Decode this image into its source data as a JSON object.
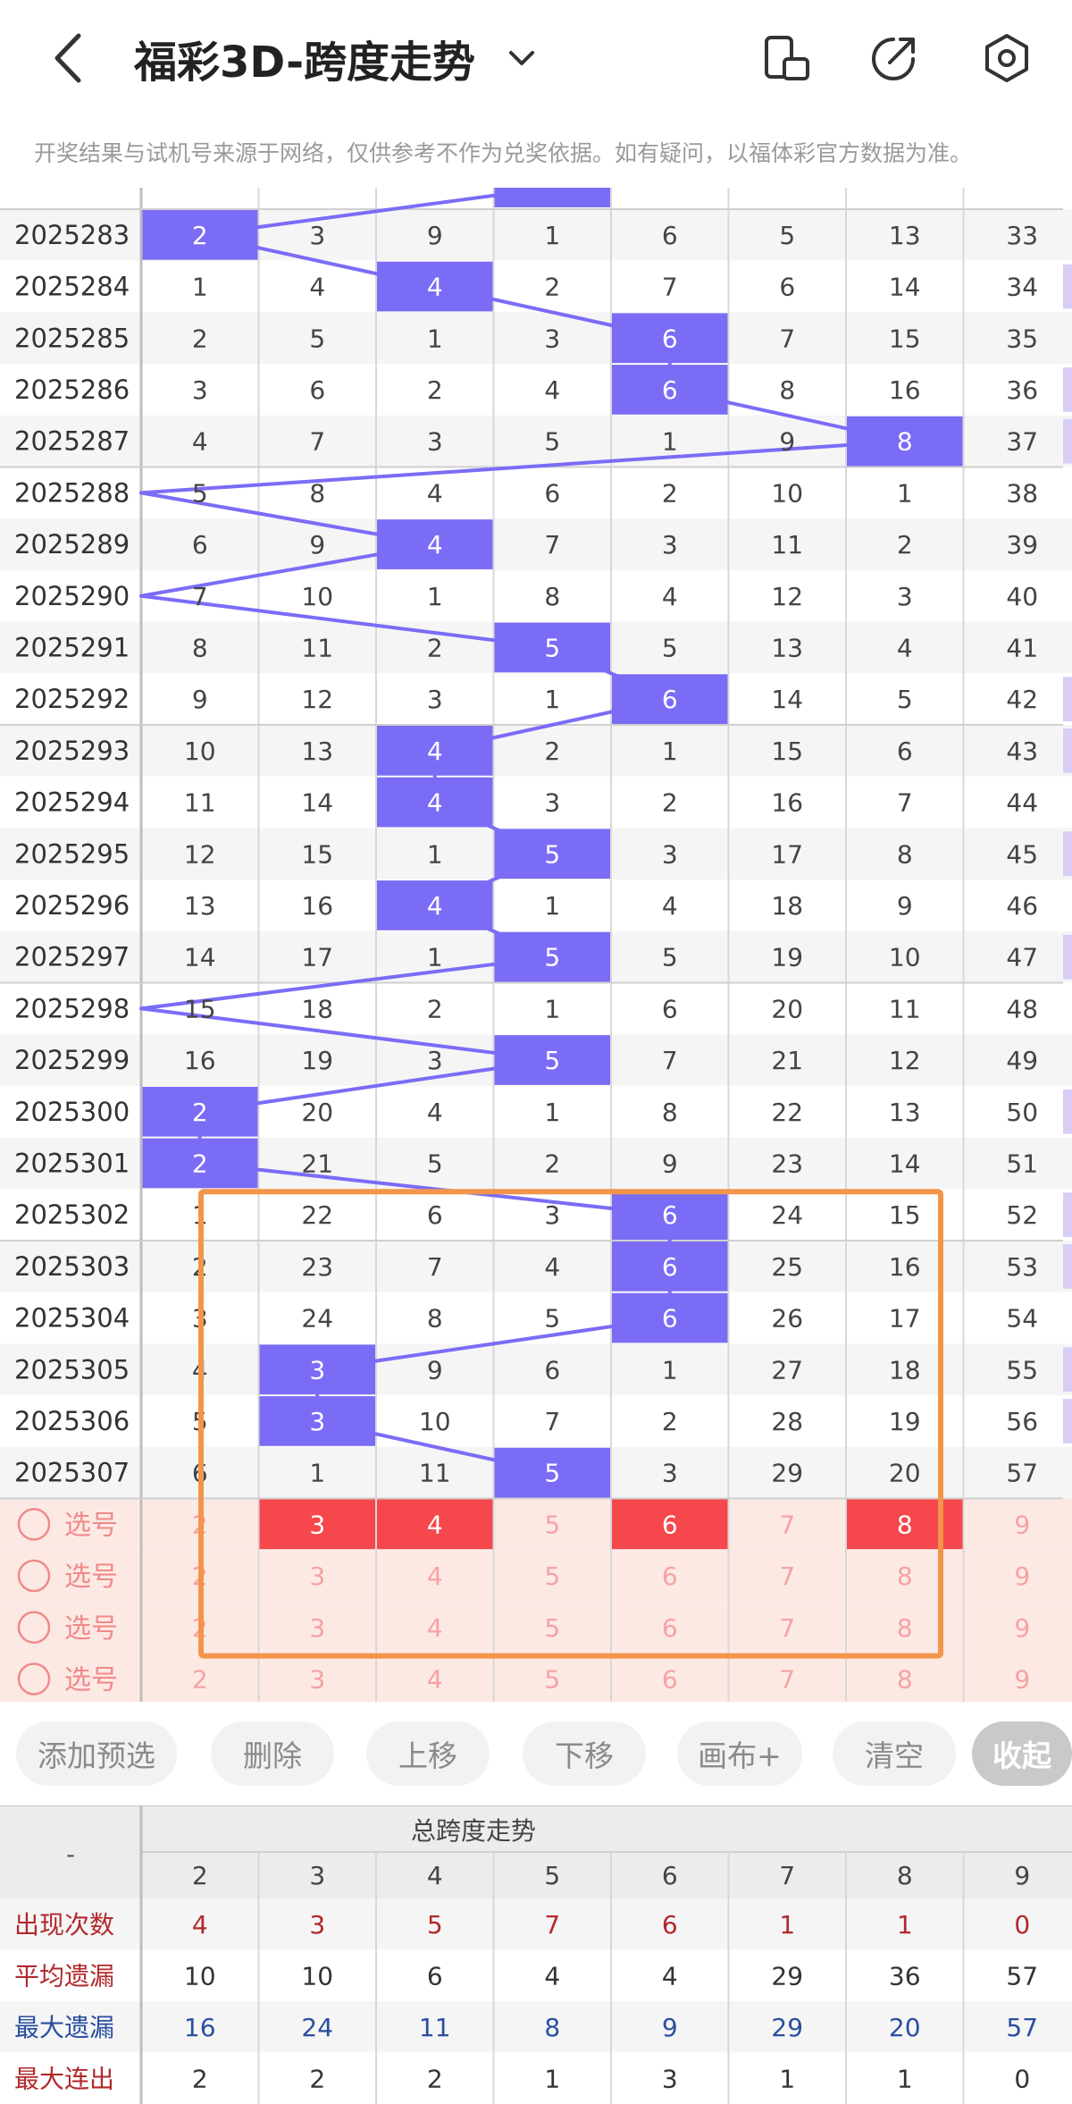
{
  "header": {
    "title": "福彩3D-跨度走势",
    "notice": "开奖结果与试机号来源于网络，仅供参考不作为兑奖依据。如有疑问，以福体彩官方数据为准。"
  },
  "icons": {
    "back": "back-arrow-icon",
    "dropdown": "chevron-down-icon",
    "phone": "phone-rotate-icon",
    "share": "share-icon",
    "settings": "settings-gear-icon"
  },
  "colors": {
    "highlight": "#7B6CF6",
    "pick": "#F5474C",
    "pick_bg": "#FDE9E4",
    "stat_red": "#B2292C",
    "stat_blue": "#2A4FA0",
    "box": "#F2954B"
  },
  "columns": [
    "2",
    "3",
    "4",
    "5",
    "6",
    "7",
    "8",
    "9"
  ],
  "rows": [
    {
      "issue": "2025283",
      "vals": [
        "2",
        "3",
        "9",
        "1",
        "6",
        "5",
        "13",
        "33"
      ],
      "hit": 0
    },
    {
      "issue": "2025284",
      "vals": [
        "1",
        "4",
        "4",
        "2",
        "7",
        "6",
        "14",
        "34"
      ],
      "hit": 2
    },
    {
      "issue": "2025285",
      "vals": [
        "2",
        "5",
        "1",
        "3",
        "6",
        "7",
        "15",
        "35"
      ],
      "hit": 4
    },
    {
      "issue": "2025286",
      "vals": [
        "3",
        "6",
        "2",
        "4",
        "6",
        "8",
        "16",
        "36"
      ],
      "hit": 4
    },
    {
      "issue": "2025287",
      "vals": [
        "4",
        "7",
        "3",
        "5",
        "1",
        "9",
        "8",
        "37"
      ],
      "hit": 6
    },
    {
      "issue": "2025288",
      "vals": [
        "5",
        "8",
        "4",
        "6",
        "2",
        "10",
        "1",
        "38"
      ],
      "hit": -1
    },
    {
      "issue": "2025289",
      "vals": [
        "6",
        "9",
        "4",
        "7",
        "3",
        "11",
        "2",
        "39"
      ],
      "hit": 2
    },
    {
      "issue": "2025290",
      "vals": [
        "7",
        "10",
        "1",
        "8",
        "4",
        "12",
        "3",
        "40"
      ],
      "hit": -1
    },
    {
      "issue": "2025291",
      "vals": [
        "8",
        "11",
        "2",
        "5",
        "5",
        "13",
        "4",
        "41"
      ],
      "hit": 3
    },
    {
      "issue": "2025292",
      "vals": [
        "9",
        "12",
        "3",
        "1",
        "6",
        "14",
        "5",
        "42"
      ],
      "hit": 4
    },
    {
      "issue": "2025293",
      "vals": [
        "10",
        "13",
        "4",
        "2",
        "1",
        "15",
        "6",
        "43"
      ],
      "hit": 2
    },
    {
      "issue": "2025294",
      "vals": [
        "11",
        "14",
        "4",
        "3",
        "2",
        "16",
        "7",
        "44"
      ],
      "hit": 2
    },
    {
      "issue": "2025295",
      "vals": [
        "12",
        "15",
        "1",
        "5",
        "3",
        "17",
        "8",
        "45"
      ],
      "hit": 3
    },
    {
      "issue": "2025296",
      "vals": [
        "13",
        "16",
        "4",
        "1",
        "4",
        "18",
        "9",
        "46"
      ],
      "hit": 2
    },
    {
      "issue": "2025297",
      "vals": [
        "14",
        "17",
        "1",
        "5",
        "5",
        "19",
        "10",
        "47"
      ],
      "hit": 3
    },
    {
      "issue": "2025298",
      "vals": [
        "15",
        "18",
        "2",
        "1",
        "6",
        "20",
        "11",
        "48"
      ],
      "hit": -1
    },
    {
      "issue": "2025299",
      "vals": [
        "16",
        "19",
        "3",
        "5",
        "7",
        "21",
        "12",
        "49"
      ],
      "hit": 3
    },
    {
      "issue": "2025300",
      "vals": [
        "2",
        "20",
        "4",
        "1",
        "8",
        "22",
        "13",
        "50"
      ],
      "hit": 0
    },
    {
      "issue": "2025301",
      "vals": [
        "2",
        "21",
        "5",
        "2",
        "9",
        "23",
        "14",
        "51"
      ],
      "hit": 0
    },
    {
      "issue": "2025302",
      "vals": [
        "1",
        "22",
        "6",
        "3",
        "6",
        "24",
        "15",
        "52"
      ],
      "hit": 4
    },
    {
      "issue": "2025303",
      "vals": [
        "2",
        "23",
        "7",
        "4",
        "6",
        "25",
        "16",
        "53"
      ],
      "hit": 4
    },
    {
      "issue": "2025304",
      "vals": [
        "3",
        "24",
        "8",
        "5",
        "6",
        "26",
        "17",
        "54"
      ],
      "hit": 4
    },
    {
      "issue": "2025305",
      "vals": [
        "4",
        "3",
        "9",
        "6",
        "1",
        "27",
        "18",
        "55"
      ],
      "hit": 1
    },
    {
      "issue": "2025306",
      "vals": [
        "5",
        "3",
        "10",
        "7",
        "2",
        "28",
        "19",
        "56"
      ],
      "hit": 1
    },
    {
      "issue": "2025307",
      "vals": [
        "6",
        "1",
        "11",
        "5",
        "3",
        "29",
        "20",
        "57"
      ],
      "hit": 3
    }
  ],
  "pick_rows": [
    {
      "label": "选号",
      "vals": [
        "2",
        "3",
        "4",
        "5",
        "6",
        "7",
        "8",
        "9"
      ],
      "selected": [
        1,
        2,
        4,
        6
      ]
    },
    {
      "label": "选号",
      "vals": [
        "2",
        "3",
        "4",
        "5",
        "6",
        "7",
        "8",
        "9"
      ],
      "selected": []
    },
    {
      "label": "选号",
      "vals": [
        "2",
        "3",
        "4",
        "5",
        "6",
        "7",
        "8",
        "9"
      ],
      "selected": []
    },
    {
      "label": "选号",
      "vals": [
        "2",
        "3",
        "4",
        "5",
        "6",
        "7",
        "8",
        "9"
      ],
      "selected": []
    }
  ],
  "buttons": [
    "添加预选",
    "删除",
    "上移",
    "下移",
    "画布+",
    "清空",
    "收起"
  ],
  "stats": {
    "corner": "-",
    "title": "总跨度走势",
    "columns": [
      "2",
      "3",
      "4",
      "5",
      "6",
      "7",
      "8",
      "9"
    ],
    "rows": [
      {
        "label": "出现次数",
        "vals": [
          "4",
          "3",
          "5",
          "7",
          "6",
          "1",
          "1",
          "0"
        ],
        "color": "red"
      },
      {
        "label": "平均遗漏",
        "vals": [
          "10",
          "10",
          "6",
          "4",
          "4",
          "29",
          "36",
          "57"
        ],
        "color": "red"
      },
      {
        "label": "最大遗漏",
        "vals": [
          "16",
          "24",
          "11",
          "8",
          "9",
          "29",
          "20",
          "57"
        ],
        "color": "blue"
      },
      {
        "label": "最大连出",
        "vals": [
          "2",
          "2",
          "2",
          "1",
          "3",
          "1",
          "1",
          "0"
        ],
        "color": "red"
      }
    ]
  }
}
